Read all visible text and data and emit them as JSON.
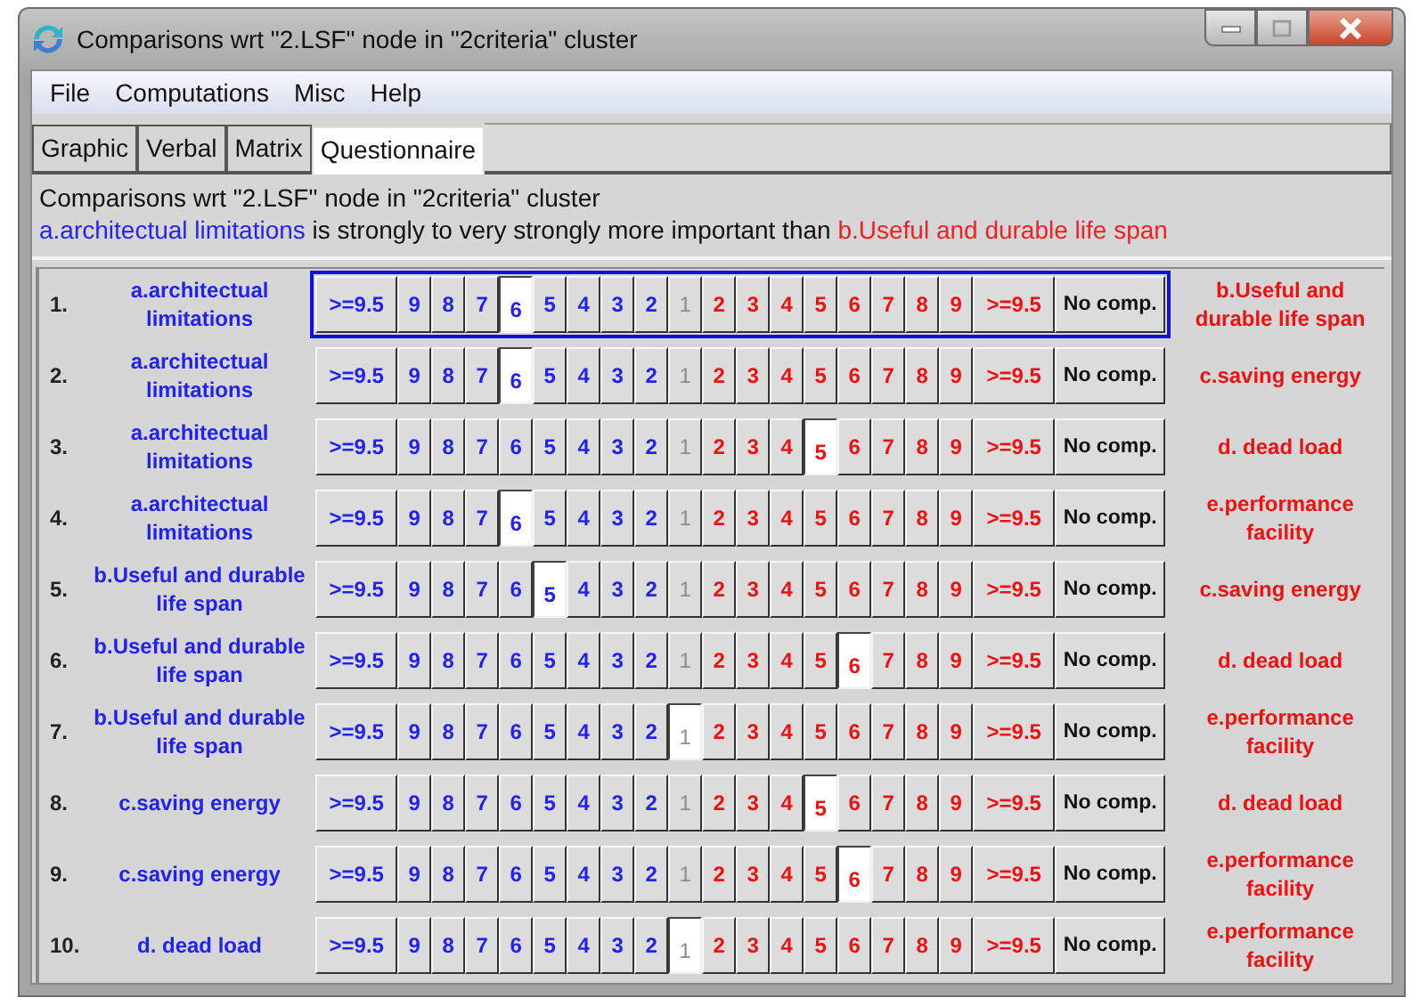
{
  "window": {
    "title": "Comparisons wrt \"2.LSF\" node in \"2criteria\" cluster"
  },
  "menu": [
    "File",
    "Computations",
    "Misc",
    "Help"
  ],
  "tabs": [
    {
      "label": "Graphic",
      "selected": false
    },
    {
      "label": "Verbal",
      "selected": false
    },
    {
      "label": "Matrix",
      "selected": false
    },
    {
      "label": "Questionnaire",
      "selected": true
    }
  ],
  "header": {
    "title": "Comparisons wrt \"2.LSF\" node in \"2criteria\" cluster",
    "left": "a.architectual limitations",
    "middle": "is strongly to very strongly more important than",
    "right": "b.Useful and durable life span"
  },
  "rows": [
    {
      "number": "1.",
      "left": "a.architectual limitations",
      "right": "b.Useful and durable life span",
      "focused": true,
      "scale": [
        {
          "label": ">=9.5",
          "kind": "left",
          "selected": false
        },
        {
          "label": "9",
          "kind": "left",
          "selected": false
        },
        {
          "label": "8",
          "kind": "left",
          "selected": false
        },
        {
          "label": "7",
          "kind": "left",
          "selected": false
        },
        {
          "label": "6",
          "kind": "left",
          "selected": true
        },
        {
          "label": "5",
          "kind": "left",
          "selected": false
        },
        {
          "label": "4",
          "kind": "left",
          "selected": false
        },
        {
          "label": "3",
          "kind": "left",
          "selected": false
        },
        {
          "label": "2",
          "kind": "left",
          "selected": false
        },
        {
          "label": "1",
          "kind": "equal",
          "selected": false
        },
        {
          "label": "2",
          "kind": "right",
          "selected": false
        },
        {
          "label": "3",
          "kind": "right",
          "selected": false
        },
        {
          "label": "4",
          "kind": "right",
          "selected": false
        },
        {
          "label": "5",
          "kind": "right",
          "selected": false
        },
        {
          "label": "6",
          "kind": "right",
          "selected": false
        },
        {
          "label": "7",
          "kind": "right",
          "selected": false
        },
        {
          "label": "8",
          "kind": "right",
          "selected": false
        },
        {
          "label": "9",
          "kind": "right",
          "selected": false
        },
        {
          "label": ">=9.5",
          "kind": "right",
          "selected": false
        },
        {
          "label": "No comp.",
          "kind": "none",
          "selected": false
        }
      ]
    },
    {
      "number": "2.",
      "left": "a.architectual limitations",
      "right": "c.saving energy",
      "focused": false,
      "scale": [
        {
          "label": ">=9.5",
          "kind": "left",
          "selected": false
        },
        {
          "label": "9",
          "kind": "left",
          "selected": false
        },
        {
          "label": "8",
          "kind": "left",
          "selected": false
        },
        {
          "label": "7",
          "kind": "left",
          "selected": false
        },
        {
          "label": "6",
          "kind": "left",
          "selected": true
        },
        {
          "label": "5",
          "kind": "left",
          "selected": false
        },
        {
          "label": "4",
          "kind": "left",
          "selected": false
        },
        {
          "label": "3",
          "kind": "left",
          "selected": false
        },
        {
          "label": "2",
          "kind": "left",
          "selected": false
        },
        {
          "label": "1",
          "kind": "equal",
          "selected": false
        },
        {
          "label": "2",
          "kind": "right",
          "selected": false
        },
        {
          "label": "3",
          "kind": "right",
          "selected": false
        },
        {
          "label": "4",
          "kind": "right",
          "selected": false
        },
        {
          "label": "5",
          "kind": "right",
          "selected": false
        },
        {
          "label": "6",
          "kind": "right",
          "selected": false
        },
        {
          "label": "7",
          "kind": "right",
          "selected": false
        },
        {
          "label": "8",
          "kind": "right",
          "selected": false
        },
        {
          "label": "9",
          "kind": "right",
          "selected": false
        },
        {
          "label": ">=9.5",
          "kind": "right",
          "selected": false
        },
        {
          "label": "No comp.",
          "kind": "none",
          "selected": false
        }
      ]
    },
    {
      "number": "3.",
      "left": "a.architectual limitations",
      "right": "d. dead load",
      "focused": false,
      "scale": [
        {
          "label": ">=9.5",
          "kind": "left",
          "selected": false
        },
        {
          "label": "9",
          "kind": "left",
          "selected": false
        },
        {
          "label": "8",
          "kind": "left",
          "selected": false
        },
        {
          "label": "7",
          "kind": "left",
          "selected": false
        },
        {
          "label": "6",
          "kind": "left",
          "selected": false
        },
        {
          "label": "5",
          "kind": "left",
          "selected": false
        },
        {
          "label": "4",
          "kind": "left",
          "selected": false
        },
        {
          "label": "3",
          "kind": "left",
          "selected": false
        },
        {
          "label": "2",
          "kind": "left",
          "selected": false
        },
        {
          "label": "1",
          "kind": "equal",
          "selected": false
        },
        {
          "label": "2",
          "kind": "right",
          "selected": false
        },
        {
          "label": "3",
          "kind": "right",
          "selected": false
        },
        {
          "label": "4",
          "kind": "right",
          "selected": false
        },
        {
          "label": "5",
          "kind": "right",
          "selected": true
        },
        {
          "label": "6",
          "kind": "right",
          "selected": false
        },
        {
          "label": "7",
          "kind": "right",
          "selected": false
        },
        {
          "label": "8",
          "kind": "right",
          "selected": false
        },
        {
          "label": "9",
          "kind": "right",
          "selected": false
        },
        {
          "label": ">=9.5",
          "kind": "right",
          "selected": false
        },
        {
          "label": "No comp.",
          "kind": "none",
          "selected": false
        }
      ]
    },
    {
      "number": "4.",
      "left": "a.architectual limitations",
      "right": "e.performance facility",
      "focused": false,
      "scale": [
        {
          "label": ">=9.5",
          "kind": "left",
          "selected": false
        },
        {
          "label": "9",
          "kind": "left",
          "selected": false
        },
        {
          "label": "8",
          "kind": "left",
          "selected": false
        },
        {
          "label": "7",
          "kind": "left",
          "selected": false
        },
        {
          "label": "6",
          "kind": "left",
          "selected": true
        },
        {
          "label": "5",
          "kind": "left",
          "selected": false
        },
        {
          "label": "4",
          "kind": "left",
          "selected": false
        },
        {
          "label": "3",
          "kind": "left",
          "selected": false
        },
        {
          "label": "2",
          "kind": "left",
          "selected": false
        },
        {
          "label": "1",
          "kind": "equal",
          "selected": false
        },
        {
          "label": "2",
          "kind": "right",
          "selected": false
        },
        {
          "label": "3",
          "kind": "right",
          "selected": false
        },
        {
          "label": "4",
          "kind": "right",
          "selected": false
        },
        {
          "label": "5",
          "kind": "right",
          "selected": false
        },
        {
          "label": "6",
          "kind": "right",
          "selected": false
        },
        {
          "label": "7",
          "kind": "right",
          "selected": false
        },
        {
          "label": "8",
          "kind": "right",
          "selected": false
        },
        {
          "label": "9",
          "kind": "right",
          "selected": false
        },
        {
          "label": ">=9.5",
          "kind": "right",
          "selected": false
        },
        {
          "label": "No comp.",
          "kind": "none",
          "selected": false
        }
      ]
    },
    {
      "number": "5.",
      "left": "b.Useful and durable life span",
      "right": "c.saving energy",
      "focused": false,
      "scale": [
        {
          "label": ">=9.5",
          "kind": "left",
          "selected": false
        },
        {
          "label": "9",
          "kind": "left",
          "selected": false
        },
        {
          "label": "8",
          "kind": "left",
          "selected": false
        },
        {
          "label": "7",
          "kind": "left",
          "selected": false
        },
        {
          "label": "6",
          "kind": "left",
          "selected": false
        },
        {
          "label": "5",
          "kind": "left",
          "selected": true
        },
        {
          "label": "4",
          "kind": "left",
          "selected": false
        },
        {
          "label": "3",
          "kind": "left",
          "selected": false
        },
        {
          "label": "2",
          "kind": "left",
          "selected": false
        },
        {
          "label": "1",
          "kind": "equal",
          "selected": false
        },
        {
          "label": "2",
          "kind": "right",
          "selected": false
        },
        {
          "label": "3",
          "kind": "right",
          "selected": false
        },
        {
          "label": "4",
          "kind": "right",
          "selected": false
        },
        {
          "label": "5",
          "kind": "right",
          "selected": false
        },
        {
          "label": "6",
          "kind": "right",
          "selected": false
        },
        {
          "label": "7",
          "kind": "right",
          "selected": false
        },
        {
          "label": "8",
          "kind": "right",
          "selected": false
        },
        {
          "label": "9",
          "kind": "right",
          "selected": false
        },
        {
          "label": ">=9.5",
          "kind": "right",
          "selected": false
        },
        {
          "label": "No comp.",
          "kind": "none",
          "selected": false
        }
      ]
    },
    {
      "number": "6.",
      "left": "b.Useful and durable life span",
      "right": "d. dead load",
      "focused": false,
      "scale": [
        {
          "label": ">=9.5",
          "kind": "left",
          "selected": false
        },
        {
          "label": "9",
          "kind": "left",
          "selected": false
        },
        {
          "label": "8",
          "kind": "left",
          "selected": false
        },
        {
          "label": "7",
          "kind": "left",
          "selected": false
        },
        {
          "label": "6",
          "kind": "left",
          "selected": false
        },
        {
          "label": "5",
          "kind": "left",
          "selected": false
        },
        {
          "label": "4",
          "kind": "left",
          "selected": false
        },
        {
          "label": "3",
          "kind": "left",
          "selected": false
        },
        {
          "label": "2",
          "kind": "left",
          "selected": false
        },
        {
          "label": "1",
          "kind": "equal",
          "selected": false
        },
        {
          "label": "2",
          "kind": "right",
          "selected": false
        },
        {
          "label": "3",
          "kind": "right",
          "selected": false
        },
        {
          "label": "4",
          "kind": "right",
          "selected": false
        },
        {
          "label": "5",
          "kind": "right",
          "selected": false
        },
        {
          "label": "6",
          "kind": "right",
          "selected": true
        },
        {
          "label": "7",
          "kind": "right",
          "selected": false
        },
        {
          "label": "8",
          "kind": "right",
          "selected": false
        },
        {
          "label": "9",
          "kind": "right",
          "selected": false
        },
        {
          "label": ">=9.5",
          "kind": "right",
          "selected": false
        },
        {
          "label": "No comp.",
          "kind": "none",
          "selected": false
        }
      ]
    },
    {
      "number": "7.",
      "left": "b.Useful and durable life span",
      "right": "e.performance facility",
      "focused": false,
      "scale": [
        {
          "label": ">=9.5",
          "kind": "left",
          "selected": false
        },
        {
          "label": "9",
          "kind": "left",
          "selected": false
        },
        {
          "label": "8",
          "kind": "left",
          "selected": false
        },
        {
          "label": "7",
          "kind": "left",
          "selected": false
        },
        {
          "label": "6",
          "kind": "left",
          "selected": false
        },
        {
          "label": "5",
          "kind": "left",
          "selected": false
        },
        {
          "label": "4",
          "kind": "left",
          "selected": false
        },
        {
          "label": "3",
          "kind": "left",
          "selected": false
        },
        {
          "label": "2",
          "kind": "left",
          "selected": false
        },
        {
          "label": "1",
          "kind": "equal",
          "selected": true
        },
        {
          "label": "2",
          "kind": "right",
          "selected": false
        },
        {
          "label": "3",
          "kind": "right",
          "selected": false
        },
        {
          "label": "4",
          "kind": "right",
          "selected": false
        },
        {
          "label": "5",
          "kind": "right",
          "selected": false
        },
        {
          "label": "6",
          "kind": "right",
          "selected": false
        },
        {
          "label": "7",
          "kind": "right",
          "selected": false
        },
        {
          "label": "8",
          "kind": "right",
          "selected": false
        },
        {
          "label": "9",
          "kind": "right",
          "selected": false
        },
        {
          "label": ">=9.5",
          "kind": "right",
          "selected": false
        },
        {
          "label": "No comp.",
          "kind": "none",
          "selected": false
        }
      ]
    },
    {
      "number": "8.",
      "left": "c.saving energy",
      "right": "d. dead load",
      "focused": false,
      "scale": [
        {
          "label": ">=9.5",
          "kind": "left",
          "selected": false
        },
        {
          "label": "9",
          "kind": "left",
          "selected": false
        },
        {
          "label": "8",
          "kind": "left",
          "selected": false
        },
        {
          "label": "7",
          "kind": "left",
          "selected": false
        },
        {
          "label": "6",
          "kind": "left",
          "selected": false
        },
        {
          "label": "5",
          "kind": "left",
          "selected": false
        },
        {
          "label": "4",
          "kind": "left",
          "selected": false
        },
        {
          "label": "3",
          "kind": "left",
          "selected": false
        },
        {
          "label": "2",
          "kind": "left",
          "selected": false
        },
        {
          "label": "1",
          "kind": "equal",
          "selected": false
        },
        {
          "label": "2",
          "kind": "right",
          "selected": false
        },
        {
          "label": "3",
          "kind": "right",
          "selected": false
        },
        {
          "label": "4",
          "kind": "right",
          "selected": false
        },
        {
          "label": "5",
          "kind": "right",
          "selected": true
        },
        {
          "label": "6",
          "kind": "right",
          "selected": false
        },
        {
          "label": "7",
          "kind": "right",
          "selected": false
        },
        {
          "label": "8",
          "kind": "right",
          "selected": false
        },
        {
          "label": "9",
          "kind": "right",
          "selected": false
        },
        {
          "label": ">=9.5",
          "kind": "right",
          "selected": false
        },
        {
          "label": "No comp.",
          "kind": "none",
          "selected": false
        }
      ]
    },
    {
      "number": "9.",
      "left": "c.saving energy",
      "right": "e.performance facility",
      "focused": false,
      "scale": [
        {
          "label": ">=9.5",
          "kind": "left",
          "selected": false
        },
        {
          "label": "9",
          "kind": "left",
          "selected": false
        },
        {
          "label": "8",
          "kind": "left",
          "selected": false
        },
        {
          "label": "7",
          "kind": "left",
          "selected": false
        },
        {
          "label": "6",
          "kind": "left",
          "selected": false
        },
        {
          "label": "5",
          "kind": "left",
          "selected": false
        },
        {
          "label": "4",
          "kind": "left",
          "selected": false
        },
        {
          "label": "3",
          "kind": "left",
          "selected": false
        },
        {
          "label": "2",
          "kind": "left",
          "selected": false
        },
        {
          "label": "1",
          "kind": "equal",
          "selected": false
        },
        {
          "label": "2",
          "kind": "right",
          "selected": false
        },
        {
          "label": "3",
          "kind": "right",
          "selected": false
        },
        {
          "label": "4",
          "kind": "right",
          "selected": false
        },
        {
          "label": "5",
          "kind": "right",
          "selected": false
        },
        {
          "label": "6",
          "kind": "right",
          "selected": true
        },
        {
          "label": "7",
          "kind": "right",
          "selected": false
        },
        {
          "label": "8",
          "kind": "right",
          "selected": false
        },
        {
          "label": "9",
          "kind": "right",
          "selected": false
        },
        {
          "label": ">=9.5",
          "kind": "right",
          "selected": false
        },
        {
          "label": "No comp.",
          "kind": "none",
          "selected": false
        }
      ]
    },
    {
      "number": "10.",
      "left": "d. dead load",
      "right": "e.performance facility",
      "focused": false,
      "scale": [
        {
          "label": ">=9.5",
          "kind": "left",
          "selected": false
        },
        {
          "label": "9",
          "kind": "left",
          "selected": false
        },
        {
          "label": "8",
          "kind": "left",
          "selected": false
        },
        {
          "label": "7",
          "kind": "left",
          "selected": false
        },
        {
          "label": "6",
          "kind": "left",
          "selected": false
        },
        {
          "label": "5",
          "kind": "left",
          "selected": false
        },
        {
          "label": "4",
          "kind": "left",
          "selected": false
        },
        {
          "label": "3",
          "kind": "left",
          "selected": false
        },
        {
          "label": "2",
          "kind": "left",
          "selected": false
        },
        {
          "label": "1",
          "kind": "equal",
          "selected": true
        },
        {
          "label": "2",
          "kind": "right",
          "selected": false
        },
        {
          "label": "3",
          "kind": "right",
          "selected": false
        },
        {
          "label": "4",
          "kind": "right",
          "selected": false
        },
        {
          "label": "5",
          "kind": "right",
          "selected": false
        },
        {
          "label": "6",
          "kind": "right",
          "selected": false
        },
        {
          "label": "7",
          "kind": "right",
          "selected": false
        },
        {
          "label": "8",
          "kind": "right",
          "selected": false
        },
        {
          "label": "9",
          "kind": "right",
          "selected": false
        },
        {
          "label": ">=9.5",
          "kind": "right",
          "selected": false
        },
        {
          "label": "No comp.",
          "kind": "none",
          "selected": false
        }
      ]
    }
  ]
}
